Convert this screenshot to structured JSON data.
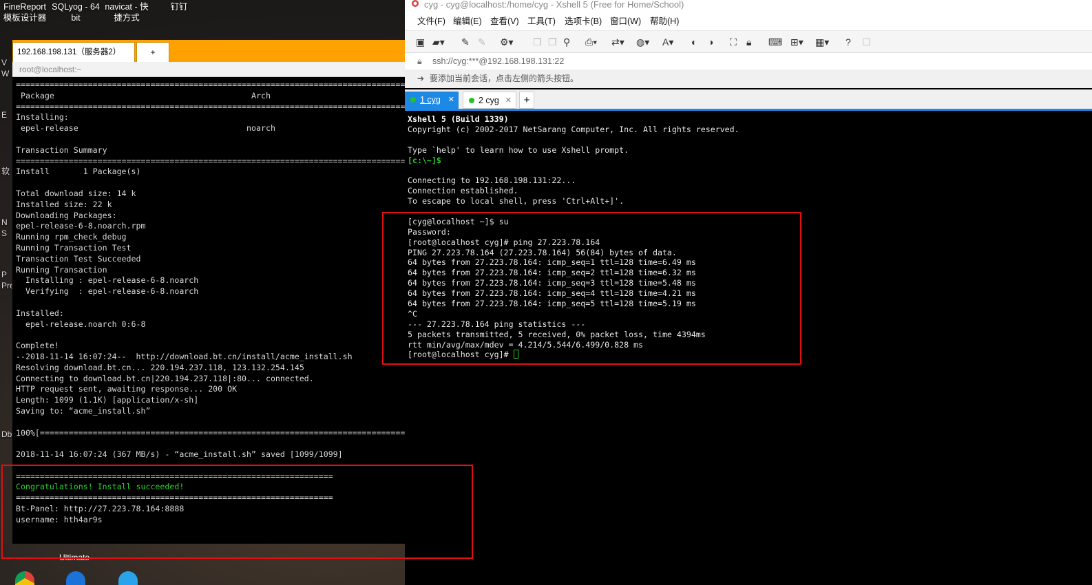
{
  "desktop": {
    "icons": [
      {
        "line1": "FineReport",
        "line2": "模板设计器"
      },
      {
        "line1": "SQLyog - 64",
        "line2": "bit"
      },
      {
        "line1": "navicat - 快",
        "line2": "捷方式"
      },
      {
        "line1": "钉钉",
        "line2": ""
      }
    ],
    "side_glyphs": [
      "V",
      "W",
      "E",
      "软",
      "N",
      "S",
      "P",
      "Pre",
      "Db"
    ],
    "taskbar_label": "Ultimate"
  },
  "left_window": {
    "tab_label": "192.168.198.131（服务器2）",
    "tab_plus": "+",
    "title": "root@localhost:~",
    "lines": [
      "===========================================================================================",
      " Package                                         Arch",
      "===========================================================================================",
      "Installing:",
      " epel-release                                   noarch",
      "",
      "Transaction Summary",
      "===========================================================================================",
      "Install       1 Package(s)",
      "",
      "Total download size: 14 k",
      "Installed size: 22 k",
      "Downloading Packages:",
      "epel-release-6-8.noarch.rpm",
      "Running rpm_check_debug",
      "Running Transaction Test",
      "Transaction Test Succeeded",
      "Running Transaction",
      "  Installing : epel-release-6-8.noarch",
      "  Verifying  : epel-release-6-8.noarch",
      "",
      "Installed:",
      "  epel-release.noarch 0:6-8",
      "",
      "Complete!",
      "--2018-11-14 16:07:24--  http://download.bt.cn/install/acme_install.sh",
      "Resolving download.bt.cn... 220.194.237.118, 123.132.254.145",
      "Connecting to download.bt.cn|220.194.237.118|:80... connected.",
      "HTTP request sent, awaiting response... 200 OK",
      "Length: 1099 (1.1K) [application/x-sh]",
      "Saving to: “acme_install.sh”",
      "",
      "100%[========================================================================================",
      "",
      "2018-11-14 16:07:24 (367 MB/s) - “acme_install.sh” saved [1099/1099]",
      "",
      "==================================================================",
      "Congratulations! Install succeeded!",
      "==================================================================",
      "Bt-Panel: http://27.223.78.164:8888",
      "username: hth4ar9s"
    ]
  },
  "xshell": {
    "title": "cyg - cyg@localhost:/home/cyg - Xshell 5 (Free for Home/School)",
    "menu": [
      "文件(F)",
      "编辑(E)",
      "查看(V)",
      "工具(T)",
      "选项卡(B)",
      "窗口(W)",
      "帮助(H)"
    ],
    "address": "ssh://cyg:***@192.168.198.131:22",
    "hint": "要添加当前会话，点击左侧的箭头按钮。",
    "tabs": [
      {
        "label": "1 cyg",
        "close": "✕"
      },
      {
        "label": "2 cyg",
        "close": "✕"
      }
    ],
    "tab_plus": "+",
    "terminal": {
      "banner": "Xshell 5 (Build 1339)",
      "copyright": "Copyright (c) 2002-2017 NetSarang Computer, Inc. All rights reserved.",
      "help": "Type `help' to learn how to use Xshell prompt.",
      "local_prompt": "[c:\\~]$",
      "connect_lines": [
        "Connecting to 192.168.198.131:22...",
        "Connection established.",
        "To escape to local shell, press 'Ctrl+Alt+]'."
      ],
      "session_lines": [
        "[cyg@localhost ~]$ su",
        "Password:",
        "[root@localhost cyg]# ping 27.223.78.164",
        "PING 27.223.78.164 (27.223.78.164) 56(84) bytes of data.",
        "64 bytes from 27.223.78.164: icmp_seq=1 ttl=128 time=6.49 ms",
        "64 bytes from 27.223.78.164: icmp_seq=2 ttl=128 time=6.32 ms",
        "64 bytes from 27.223.78.164: icmp_seq=3 ttl=128 time=5.48 ms",
        "64 bytes from 27.223.78.164: icmp_seq=4 ttl=128 time=4.21 ms",
        "64 bytes from 27.223.78.164: icmp_seq=5 ttl=128 time=5.19 ms",
        "^C",
        "--- 27.223.78.164 ping statistics ---",
        "5 packets transmitted, 5 received, 0% packet loss, time 4394ms",
        "rtt min/avg/max/mdev = 4.214/5.544/6.499/0.828 ms"
      ],
      "final_prompt": "[root@localhost cyg]# "
    }
  },
  "colors": {
    "orange_tabbar": "#ffa200",
    "xshell_tab_blue": "#1e88e5",
    "highlight_red": "#e01010",
    "terminal_green": "#2bd12b"
  }
}
